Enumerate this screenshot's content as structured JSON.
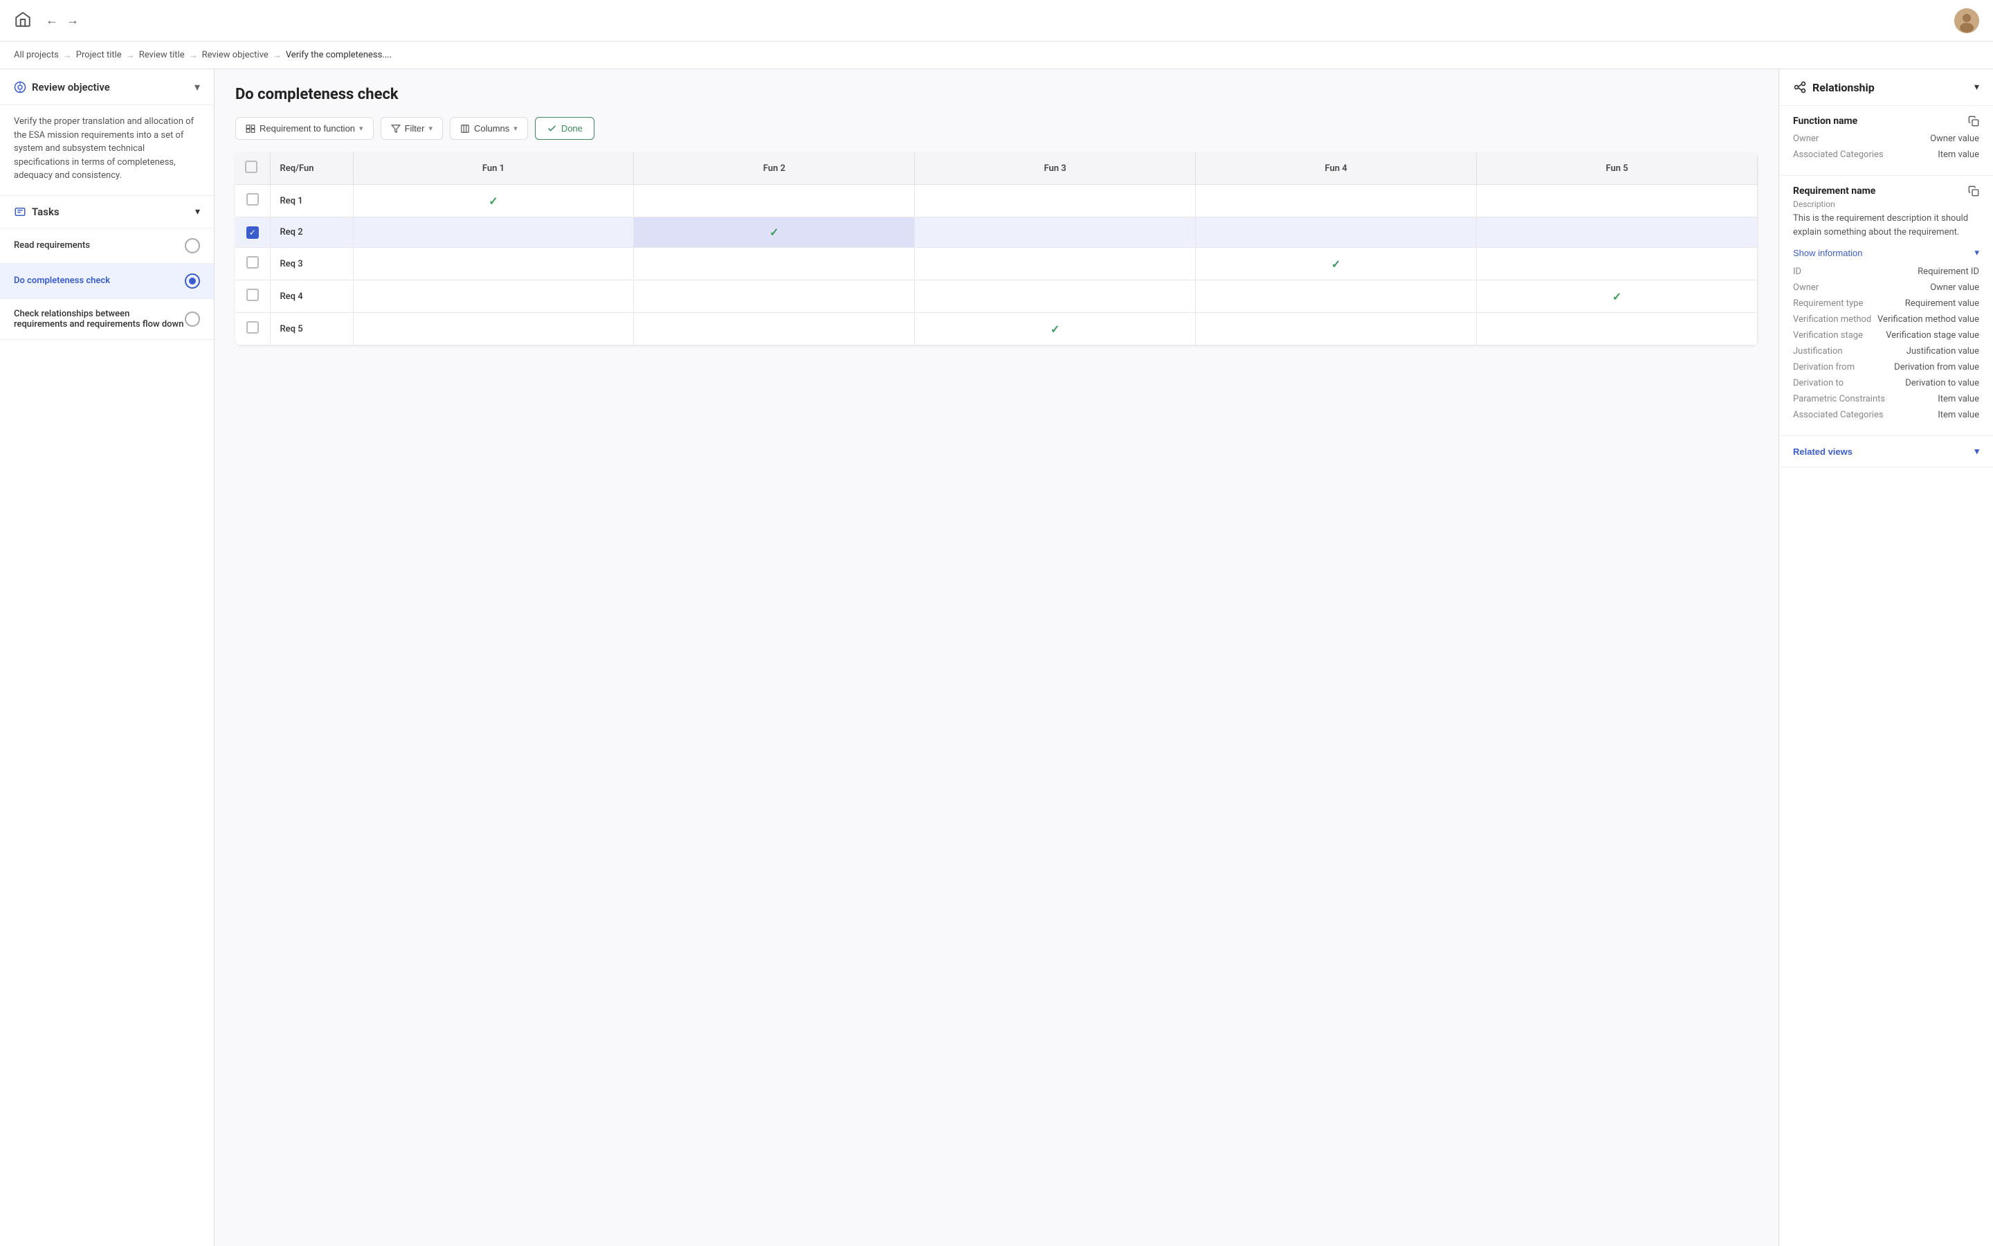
{
  "topbar": {
    "home_label": "home",
    "back_label": "←",
    "forward_label": "→"
  },
  "breadcrumb": {
    "items": [
      {
        "label": "All projects",
        "sep": true
      },
      {
        "label": "Project title",
        "sep": true
      },
      {
        "label": "Review title",
        "sep": true
      },
      {
        "label": "Review objective",
        "sep": true
      },
      {
        "label": "Verify the completeness....",
        "sep": false
      }
    ]
  },
  "left_sidebar": {
    "review_objective_label": "Review objective",
    "chevron_label": "▾",
    "objective_text": "Verify the proper translation and allocation of the ESA mission requirements into a set of system and subsystem technical specifications in terms of completeness, adequacy and consistency.",
    "tasks_label": "Tasks",
    "task_items": [
      {
        "label": "Read requirements",
        "active": false,
        "state": "empty"
      },
      {
        "label": "Do completeness check",
        "active": true,
        "state": "partial"
      },
      {
        "label": "Check relationships between requirements and requirements flow down",
        "active": false,
        "state": "empty"
      }
    ]
  },
  "main": {
    "title": "Do completeness check",
    "toolbar": {
      "view_selector": "Requirement to function",
      "filter_label": "Filter",
      "columns_label": "Columns",
      "done_label": "Done"
    },
    "table": {
      "columns": [
        "Req/Fun",
        "Fun 1",
        "Fun 2",
        "Fun 3",
        "Fun 4",
        "Fun 5"
      ],
      "rows": [
        {
          "name": "Req 1",
          "selected": false,
          "checks": [
            1,
            0,
            0,
            0,
            0
          ]
        },
        {
          "name": "Req 2",
          "selected": true,
          "checks": [
            0,
            1,
            0,
            0,
            0
          ]
        },
        {
          "name": "Req 3",
          "selected": false,
          "checks": [
            0,
            0,
            0,
            1,
            0
          ]
        },
        {
          "name": "Req 4",
          "selected": false,
          "checks": [
            0,
            0,
            0,
            0,
            1
          ]
        },
        {
          "name": "Req 5",
          "selected": false,
          "checks": [
            0,
            0,
            1,
            0,
            0
          ]
        }
      ]
    }
  },
  "right_sidebar": {
    "title": "Relationship",
    "chevron": "▾",
    "function_section": {
      "title": "Function name",
      "owner_label": "Owner",
      "owner_value": "Owner value",
      "categories_label": "Associated Categories",
      "categories_value": "Item value"
    },
    "requirement_section": {
      "title": "Requirement name",
      "description_label": "Description",
      "description_text": "This is the requirement description it should explain something about the requirement.",
      "show_info_label": "Show information",
      "info_rows": [
        {
          "label": "ID",
          "value": "Requirement ID"
        },
        {
          "label": "Owner",
          "value": "Owner value"
        },
        {
          "label": "Requirement type",
          "value": "Requirement value"
        },
        {
          "label": "Verification method",
          "value": "Verification method value"
        },
        {
          "label": "Verification stage",
          "value": "Verification stage value"
        },
        {
          "label": "Justification",
          "value": "Justification value"
        },
        {
          "label": "Derivation from",
          "value": "Derivation from value"
        },
        {
          "label": "Derivation to",
          "value": "Derivation to value"
        },
        {
          "label": "Parametric Constraints",
          "value": "Item value"
        },
        {
          "label": "Associated Categories",
          "value": "Item value"
        }
      ]
    },
    "related_views_label": "Related views"
  }
}
